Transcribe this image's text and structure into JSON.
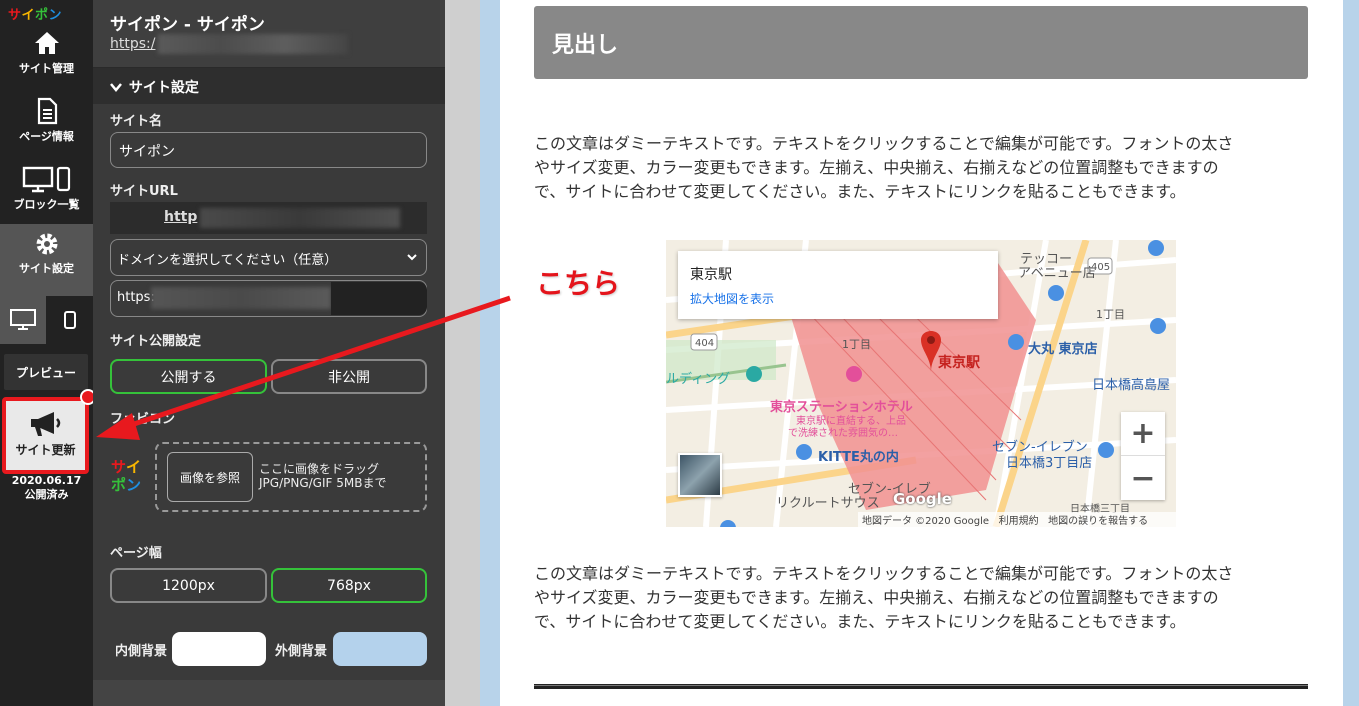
{
  "rail": {
    "logo": "サイポン",
    "items": [
      {
        "label": "サイト管理"
      },
      {
        "label": "ページ情報"
      },
      {
        "label": "ブロック一覧"
      },
      {
        "label": "サイト設定"
      }
    ],
    "preview_label": "プレビュー",
    "update_label": "サイト更新",
    "publish_date": "2020.06.17",
    "publish_status": "公開済み"
  },
  "panel": {
    "site_title": "サイポン - サイポン",
    "site_url_prefix": "https:/",
    "section_title": "サイト設定",
    "site_name_label": "サイト名",
    "site_name_value": "サイポン",
    "site_url_label": "サイトURL",
    "site_url_value_prefix": "http",
    "domain_select": "ドメインを選択してください（任意）",
    "https_prefix": "https:",
    "publish_label": "サイト公開設定",
    "publish_on": "公開する",
    "publish_off": "非公開",
    "favicon_label": "ファビコン",
    "browse_button": "画像を参照",
    "upload_hint_line1": "ここに画像をドラッグ",
    "upload_hint_line2": "JPG/PNG/GIF 5MBまで",
    "page_width_label": "ページ幅",
    "width_1200": "1200px",
    "width_768": "768px",
    "inner_bg_label": "内側背景",
    "outer_bg_label": "外側背景",
    "inner_bg_color": "#ffffff",
    "outer_bg_color": "#b4d2ec"
  },
  "content": {
    "heading": "見出し",
    "paragraph_line1": "この文章はダミーテキストです。テキストをクリックすることで編集が可能です。フォントの太さ",
    "paragraph_line2": "やサイズ変更、カラー変更もできます。左揃え、中央揃え、右揃えなどの位置調整もできますの",
    "paragraph_line3": "で、サイトに合わせて変更してください。また、テキストにリンクを貼ることもできます。",
    "annotation": "こちら"
  },
  "map": {
    "place_name": "東京駅",
    "enlarge_link": "拡大地図を表示",
    "labels": {
      "station": "東京駅",
      "hotel": "東京ステーションホテル",
      "hotel_sub1": "東京駅に直結する、上品",
      "hotel_sub2": "で洗練された雰囲気の…",
      "daimaru": "大丸 東京店",
      "kitte": "KITTE丸の内",
      "seven1": "セブン-イレブン",
      "seven2": "日本橋3丁目店",
      "takashimaya": "日本橋高島屋",
      "recruit": "リクルートサウス",
      "route404": "404",
      "route405": "405",
      "chome": "1丁目",
      "chome2": "1丁目",
      "building": "ルディング",
      "tekko1": "テッコー",
      "tekko2": "アベニュー店",
      "nihonbashi3": "日本橋三丁目",
      "seven_top": "セブン-イレブ"
    },
    "zoom_in": "+",
    "zoom_out": "−",
    "google": "Google",
    "attr_data": "地図データ ©2020 Google",
    "attr_terms": "利用規約",
    "attr_report": "地図の誤りを報告する"
  }
}
